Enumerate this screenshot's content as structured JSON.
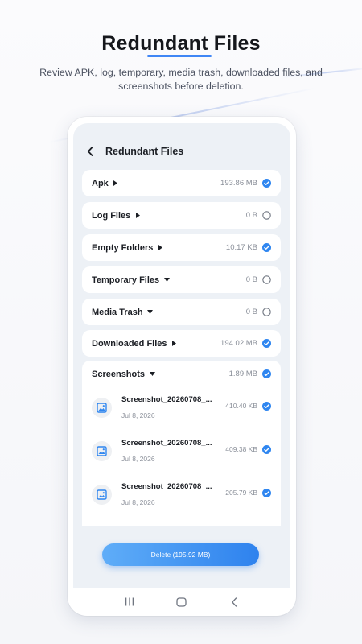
{
  "header": {
    "title": "Redundant Files",
    "subtitle": "Review APK, log, temporary, media trash, downloaded files, and screenshots before deletion."
  },
  "app": {
    "title": "Redundant Files",
    "icons": {
      "back": "back-arrow-icon",
      "check": "checked-circle-icon",
      "uncheck": "empty-circle-icon",
      "image": "image-icon"
    },
    "colors": {
      "accent": "#2f86f0",
      "screen_bg": "#edf1f6",
      "button": "#3a8df2"
    },
    "categories": [
      {
        "label": "Apk",
        "size": "193.86 MB",
        "checked": true,
        "expand": "right"
      },
      {
        "label": "Log Files",
        "size": "0 B",
        "checked": false,
        "expand": "right"
      },
      {
        "label": "Empty Folders",
        "size": "10.17 KB",
        "checked": true,
        "expand": "right"
      },
      {
        "label": "Temporary Files",
        "size": "0 B",
        "checked": false,
        "expand": "down"
      },
      {
        "label": "Media Trash",
        "size": "0 B",
        "checked": false,
        "expand": "down"
      },
      {
        "label": "Downloaded Files",
        "size": "194.02 MB",
        "checked": true,
        "expand": "right"
      }
    ],
    "screenshots": {
      "label": "Screenshots",
      "size": "1.89 MB",
      "checked": true,
      "expand": "down",
      "files": [
        {
          "name": "Screenshot_20260708_...",
          "date": "Jul 8, 2026",
          "size": "410.40 KB",
          "checked": true
        },
        {
          "name": "Screenshot_20260708_...",
          "date": "Jul 8, 2026",
          "size": "409.38 KB",
          "checked": true
        },
        {
          "name": "Screenshot_20260708_...",
          "date": "Jul 8, 2026",
          "size": "205.79 KB",
          "checked": true
        }
      ]
    },
    "delete_button": "Delete (195.92 MB)"
  },
  "navbar": {
    "icons": [
      "recents-icon",
      "home-icon",
      "back-icon"
    ]
  }
}
